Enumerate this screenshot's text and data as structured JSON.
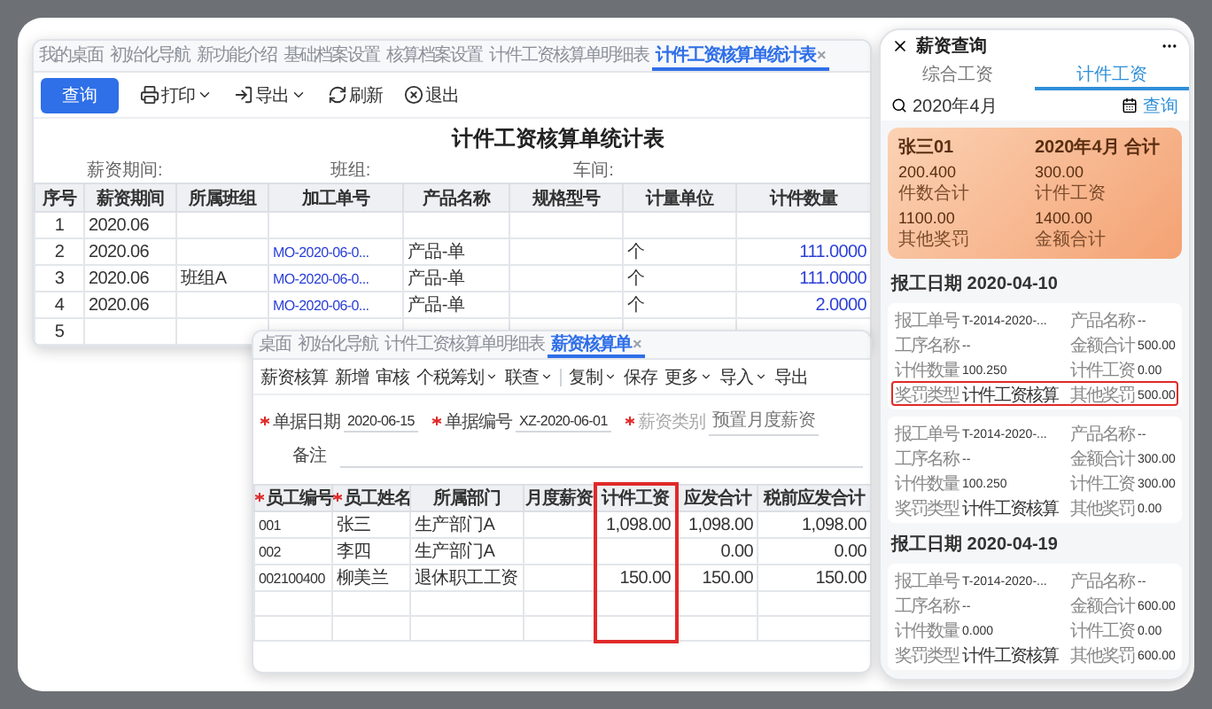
{
  "back_window": {
    "tabs": [
      {
        "label": "我的桌面",
        "selected": false
      },
      {
        "label": "初始化导航",
        "selected": false
      },
      {
        "label": "新功能介绍",
        "selected": false
      },
      {
        "label": "基础档案设置",
        "selected": false
      },
      {
        "label": "核算档案设置",
        "selected": false
      },
      {
        "label": "计件工资核算单明细表",
        "selected": false
      },
      {
        "label": "计件工资核算单统计表",
        "selected": true,
        "close": "×"
      }
    ],
    "toolbar": [
      {
        "kind": "primary",
        "label": "查询"
      },
      {
        "kind": "tool",
        "label": "打印",
        "dropdown": true
      },
      {
        "kind": "tool",
        "label": "导出",
        "dropdown": true
      },
      {
        "kind": "tool",
        "label": "刷新",
        "dropdown": false
      },
      {
        "kind": "tool",
        "label": "退出",
        "dropdown": false
      }
    ],
    "report_title": "计件工资核算单统计表",
    "filters": [
      "薪资期间:",
      "班组:",
      "车间:"
    ],
    "table": {
      "columns": [
        {
          "label": "序号",
          "kind": "center"
        },
        {
          "label": "薪资期间",
          "kind": "text"
        },
        {
          "label": "所属班组",
          "kind": "text"
        },
        {
          "label": "加工单号",
          "kind": "link"
        },
        {
          "label": "产品名称",
          "kind": "text"
        },
        {
          "label": "规格型号",
          "kind": "text"
        },
        {
          "label": "计量单位",
          "kind": "text"
        },
        {
          "label": "计件数量",
          "kind": "number-link"
        }
      ],
      "rows": [
        [
          "1",
          "2020.06",
          null,
          null,
          null,
          null,
          null,
          null
        ],
        [
          "2",
          "2020.06",
          null,
          "MO-2020-06-0...",
          "产品-单",
          null,
          "个",
          "111.0000"
        ],
        [
          "3",
          "2020.06",
          "班组A",
          "MO-2020-06-0...",
          "产品-单",
          null,
          "个",
          "111.0000"
        ],
        [
          "4",
          "2020.06",
          null,
          "MO-2020-06-0...",
          "产品-单",
          null,
          "个",
          "2.0000"
        ],
        [
          "5",
          null,
          null,
          null,
          null,
          null,
          null,
          null
        ]
      ]
    }
  },
  "front_window": {
    "tabs": [
      {
        "label": "桌面",
        "selected": false
      },
      {
        "label": "初始化导航",
        "selected": false
      },
      {
        "label": "计件工资核算单明细表",
        "selected": false
      },
      {
        "label": "薪资核算单",
        "selected": true,
        "close": "×"
      }
    ],
    "toolbar_groups": [
      [
        {
          "label": "薪资核算",
          "dropdown": false
        },
        {
          "label": "新增",
          "dropdown": false
        },
        {
          "label": "审核",
          "dropdown": false
        },
        {
          "label": "个税筹划",
          "dropdown": true
        },
        {
          "label": "联查",
          "dropdown": true
        }
      ],
      [
        {
          "label": "复制",
          "dropdown": true
        },
        {
          "label": "保存",
          "dropdown": false
        },
        {
          "label": "更多",
          "dropdown": true
        },
        {
          "label": "导入",
          "dropdown": true
        },
        {
          "label": "导出",
          "dropdown": false
        }
      ]
    ],
    "fields": [
      {
        "label": "单据日期",
        "value": "2020-06-15",
        "required": true,
        "disabled": false
      },
      {
        "label": "单据编号",
        "value": "XZ-2020-06-01",
        "required": true,
        "disabled": false
      },
      {
        "label": "薪资类别",
        "value": "预置月度薪资",
        "required": true,
        "disabled": true
      }
    ],
    "remark": {
      "label": "备注"
    },
    "table": {
      "columns": [
        {
          "label": "员工编号",
          "required": true,
          "highlighted": false
        },
        {
          "label": "员工姓名",
          "required": true,
          "highlighted": false
        },
        {
          "label": "所属部门",
          "required": false,
          "highlighted": false
        },
        {
          "label": "月度薪资",
          "required": false,
          "highlighted": false
        },
        {
          "label": "计件工资",
          "required": false,
          "highlighted": true
        },
        {
          "label": "应发合计",
          "required": false,
          "highlighted": false
        },
        {
          "label": "税前应发合计",
          "required": false,
          "highlighted": false
        }
      ],
      "rows": [
        [
          "001",
          "张三",
          "生产部门A",
          null,
          "1,098.00",
          "1,098.00",
          "1,098.00"
        ],
        [
          "002",
          "李四",
          "生产部门A",
          null,
          null,
          "0.00",
          "0.00"
        ],
        [
          "002100400",
          "柳美兰",
          "退休职工工资",
          null,
          "150.00",
          "150.00",
          "150.00"
        ]
      ]
    }
  },
  "mobile": {
    "title": "薪资查询",
    "tabs": [
      {
        "label": "综合工资",
        "selected": false
      },
      {
        "label": "计件工资",
        "selected": true
      }
    ],
    "search": {
      "value": "2020年4月",
      "button": "查询"
    },
    "summary": {
      "name": "张三01",
      "period": "2020年4月 合计",
      "stats": [
        {
          "value": "200.400",
          "label": "件数合计"
        },
        {
          "value": "300.00",
          "label": "计件工资"
        },
        {
          "value": "1100.00",
          "label": "其他奖罚"
        },
        {
          "value": "1400.00",
          "label": "金额合计"
        }
      ]
    },
    "groups": [
      {
        "date": "报工日期 2020-04-10",
        "records": [
          {
            "rows": [
              {
                "highlighted": false,
                "cells": [
                  {
                    "label": "报工单号",
                    "value": "T-2014-2020-..."
                  },
                  {
                    "label": "产品名称",
                    "value": "--"
                  }
                ]
              },
              {
                "highlighted": false,
                "cells": [
                  {
                    "label": "工序名称",
                    "value": "--"
                  },
                  {
                    "label": "金额合计",
                    "value": "500.00"
                  }
                ]
              },
              {
                "highlighted": false,
                "cells": [
                  {
                    "label": "计件数量",
                    "value": "100.250"
                  },
                  {
                    "label": "计件工资",
                    "value": "0.00"
                  }
                ]
              },
              {
                "highlighted": true,
                "cells": [
                  {
                    "label": "奖罚类型",
                    "value": "计件工资核算"
                  },
                  {
                    "label": "其他奖罚",
                    "value": "500.00"
                  }
                ]
              }
            ]
          },
          {
            "rows": [
              {
                "highlighted": false,
                "cells": [
                  {
                    "label": "报工单号",
                    "value": "T-2014-2020-..."
                  },
                  {
                    "label": "产品名称",
                    "value": "--"
                  }
                ]
              },
              {
                "highlighted": false,
                "cells": [
                  {
                    "label": "工序名称",
                    "value": "--"
                  },
                  {
                    "label": "金额合计",
                    "value": "300.00"
                  }
                ]
              },
              {
                "highlighted": false,
                "cells": [
                  {
                    "label": "计件数量",
                    "value": "100.250"
                  },
                  {
                    "label": "计件工资",
                    "value": "300.00"
                  }
                ]
              },
              {
                "highlighted": false,
                "cells": [
                  {
                    "label": "奖罚类型",
                    "value": "计件工资核算"
                  },
                  {
                    "label": "其他奖罚",
                    "value": "0.00"
                  }
                ]
              }
            ]
          }
        ]
      },
      {
        "date": "报工日期 2020-04-19",
        "records": [
          {
            "rows": [
              {
                "highlighted": false,
                "cells": [
                  {
                    "label": "报工单号",
                    "value": "T-2014-2020-..."
                  },
                  {
                    "label": "产品名称",
                    "value": "--"
                  }
                ]
              },
              {
                "highlighted": false,
                "cells": [
                  {
                    "label": "工序名称",
                    "value": "--"
                  },
                  {
                    "label": "金额合计",
                    "value": "600.00"
                  }
                ]
              },
              {
                "highlighted": false,
                "cells": [
                  {
                    "label": "计件数量",
                    "value": "0.000"
                  },
                  {
                    "label": "计件工资",
                    "value": "0.00"
                  }
                ]
              },
              {
                "highlighted": false,
                "cells": [
                  {
                    "label": "奖罚类型",
                    "value": "计件工资核算"
                  },
                  {
                    "label": "其他奖罚",
                    "value": "600.00"
                  }
                ]
              }
            ]
          }
        ]
      }
    ]
  }
}
